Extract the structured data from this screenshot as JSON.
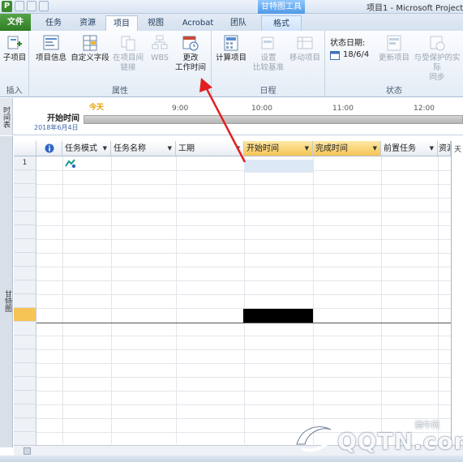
{
  "window": {
    "title": "项目1 - Microsoft Project",
    "context_group": "甘特图工具",
    "app_icon": "P"
  },
  "tabs": [
    {
      "label": "文件"
    },
    {
      "label": "任务"
    },
    {
      "label": "资源"
    },
    {
      "label": "项目"
    },
    {
      "label": "视图"
    },
    {
      "label": "Acrobat"
    },
    {
      "label": "团队"
    },
    {
      "label": "格式"
    }
  ],
  "ribbon": {
    "groups": [
      {
        "label": "插入"
      },
      {
        "label": "属性"
      },
      {
        "label": "日程"
      },
      {
        "label": "状态"
      }
    ],
    "buttons": {
      "subproject": "子项目",
      "project_info": "项目信息",
      "custom_fields": "自定义字段",
      "links_between_projects_1": "在项目间",
      "links_between_projects_2": "链接",
      "wbs": "WBS",
      "change_working_time_1": "更改",
      "change_working_time_2": "工作时间",
      "calculate_project": "计算项目",
      "set_baseline_1": "设置",
      "set_baseline_2": "比较基准",
      "move_project": "移动项目",
      "status_date_label": "状态日期:",
      "status_date_value": "18/6/4",
      "update_project": "更新项目",
      "sync_protected_1": "与受保护的实际",
      "sync_protected_2": "同步"
    }
  },
  "timeline": {
    "side_label": "时间表",
    "start_label": "开始时间",
    "start_date": "2018年6月4日",
    "today_label": "今天",
    "ticks": [
      "9:00",
      "10:00",
      "11:00",
      "12:00"
    ]
  },
  "grid": {
    "side_label": "甘特图",
    "columns": [
      "任务模式",
      "任务名称",
      "工期",
      "开始时间",
      "完成时间",
      "前置任务",
      "资源"
    ],
    "info_icon": "i",
    "row_numbers": [
      "1"
    ],
    "gantt_header": "天"
  },
  "watermark": {
    "text": "QQTN.com",
    "sub": "腾牛网"
  },
  "colors": {
    "file_tab": "#2e7d24",
    "selected_header": "#f6c455",
    "annotation_arrow": "#e02020"
  }
}
